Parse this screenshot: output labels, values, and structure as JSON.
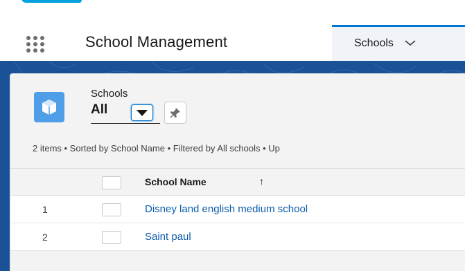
{
  "header": {
    "app_name": "School Management",
    "active_tab": "Schools",
    "logo_icon": "salesforce-cloud-icon",
    "launcher_icon": "app-launcher-grid-icon",
    "tab_icon": "chevron-down-icon"
  },
  "list_view": {
    "object_label": "Schools",
    "view_name": "All",
    "view_dropdown_icon": "caret-down-icon",
    "pin_icon": "pin-icon",
    "object_icon": "school-icon",
    "status": "2 items • Sorted by School Name • Filtered by All schools • Up"
  },
  "table": {
    "columns": [
      {
        "label": "School Name",
        "sort": "↑"
      }
    ],
    "rows": [
      {
        "num": "1",
        "school_name": "Disney land english medium school"
      },
      {
        "num": "2",
        "school_name": "Saint paul"
      }
    ]
  },
  "colors": {
    "brand_band": "#1b5297",
    "tab_accent": "#0176d3",
    "link": "#0b5cab",
    "object_icon_bg": "#4f9ee8",
    "cloud": "#00a1e0"
  }
}
